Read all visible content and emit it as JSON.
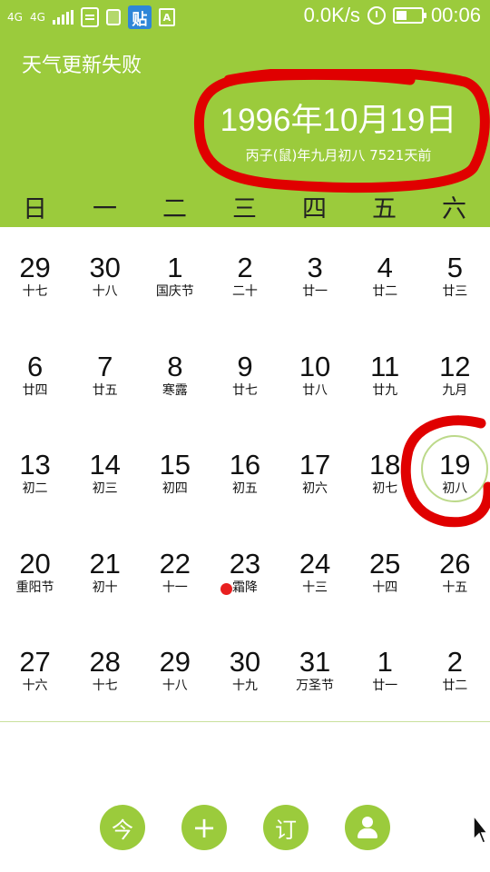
{
  "status_bar": {
    "signal_label": "4G",
    "network_speed": "0.0K/s",
    "time": "00:06",
    "badge_tie": "贴",
    "badge_a": "A",
    "icons": [
      "signal-icon",
      "document-icon",
      "copy-icon",
      "tieba-icon",
      "a-app-icon",
      "alarm-icon",
      "battery-icon"
    ]
  },
  "header": {
    "weather_status": "天气更新失败",
    "full_date": "1996年10月19日",
    "lunar_info": "丙子(鼠)年九月初八   7521天前",
    "background_color": "#9bcb3c"
  },
  "weekdays": [
    "日",
    "一",
    "二",
    "三",
    "四",
    "五",
    "六"
  ],
  "calendar": {
    "selected": "19",
    "rows": [
      [
        {
          "day": "29",
          "lunar": "十七"
        },
        {
          "day": "30",
          "lunar": "十八"
        },
        {
          "day": "1",
          "lunar": "国庆节"
        },
        {
          "day": "2",
          "lunar": "二十"
        },
        {
          "day": "3",
          "lunar": "廿一"
        },
        {
          "day": "4",
          "lunar": "廿二"
        },
        {
          "day": "5",
          "lunar": "廿三"
        }
      ],
      [
        {
          "day": "6",
          "lunar": "廿四"
        },
        {
          "day": "7",
          "lunar": "廿五"
        },
        {
          "day": "8",
          "lunar": "寒露"
        },
        {
          "day": "9",
          "lunar": "廿七"
        },
        {
          "day": "10",
          "lunar": "廿八"
        },
        {
          "day": "11",
          "lunar": "廿九"
        },
        {
          "day": "12",
          "lunar": "九月"
        }
      ],
      [
        {
          "day": "13",
          "lunar": "初二"
        },
        {
          "day": "14",
          "lunar": "初三"
        },
        {
          "day": "15",
          "lunar": "初四"
        },
        {
          "day": "16",
          "lunar": "初五"
        },
        {
          "day": "17",
          "lunar": "初六"
        },
        {
          "day": "18",
          "lunar": "初七"
        },
        {
          "day": "19",
          "lunar": "初八"
        }
      ],
      [
        {
          "day": "20",
          "lunar": "重阳节"
        },
        {
          "day": "21",
          "lunar": "初十"
        },
        {
          "day": "22",
          "lunar": "十一"
        },
        {
          "day": "23",
          "lunar": "霜降"
        },
        {
          "day": "24",
          "lunar": "十三"
        },
        {
          "day": "25",
          "lunar": "十四"
        },
        {
          "day": "26",
          "lunar": "十五"
        }
      ],
      [
        {
          "day": "27",
          "lunar": "十六"
        },
        {
          "day": "28",
          "lunar": "十七"
        },
        {
          "day": "29",
          "lunar": "十八"
        },
        {
          "day": "30",
          "lunar": "十九"
        },
        {
          "day": "31",
          "lunar": "万圣节"
        },
        {
          "day": "1",
          "lunar": "廿一"
        },
        {
          "day": "2",
          "lunar": "廿二"
        }
      ]
    ],
    "event_days": [
      "23"
    ]
  },
  "toolbar": {
    "today_label": "今",
    "add_label": "+",
    "subscribe_label": "订",
    "profile_icon": "user-icon"
  },
  "colors": {
    "accent": "#9bcb3c",
    "annotation": "#e00000",
    "event_dot": "#e82020"
  }
}
